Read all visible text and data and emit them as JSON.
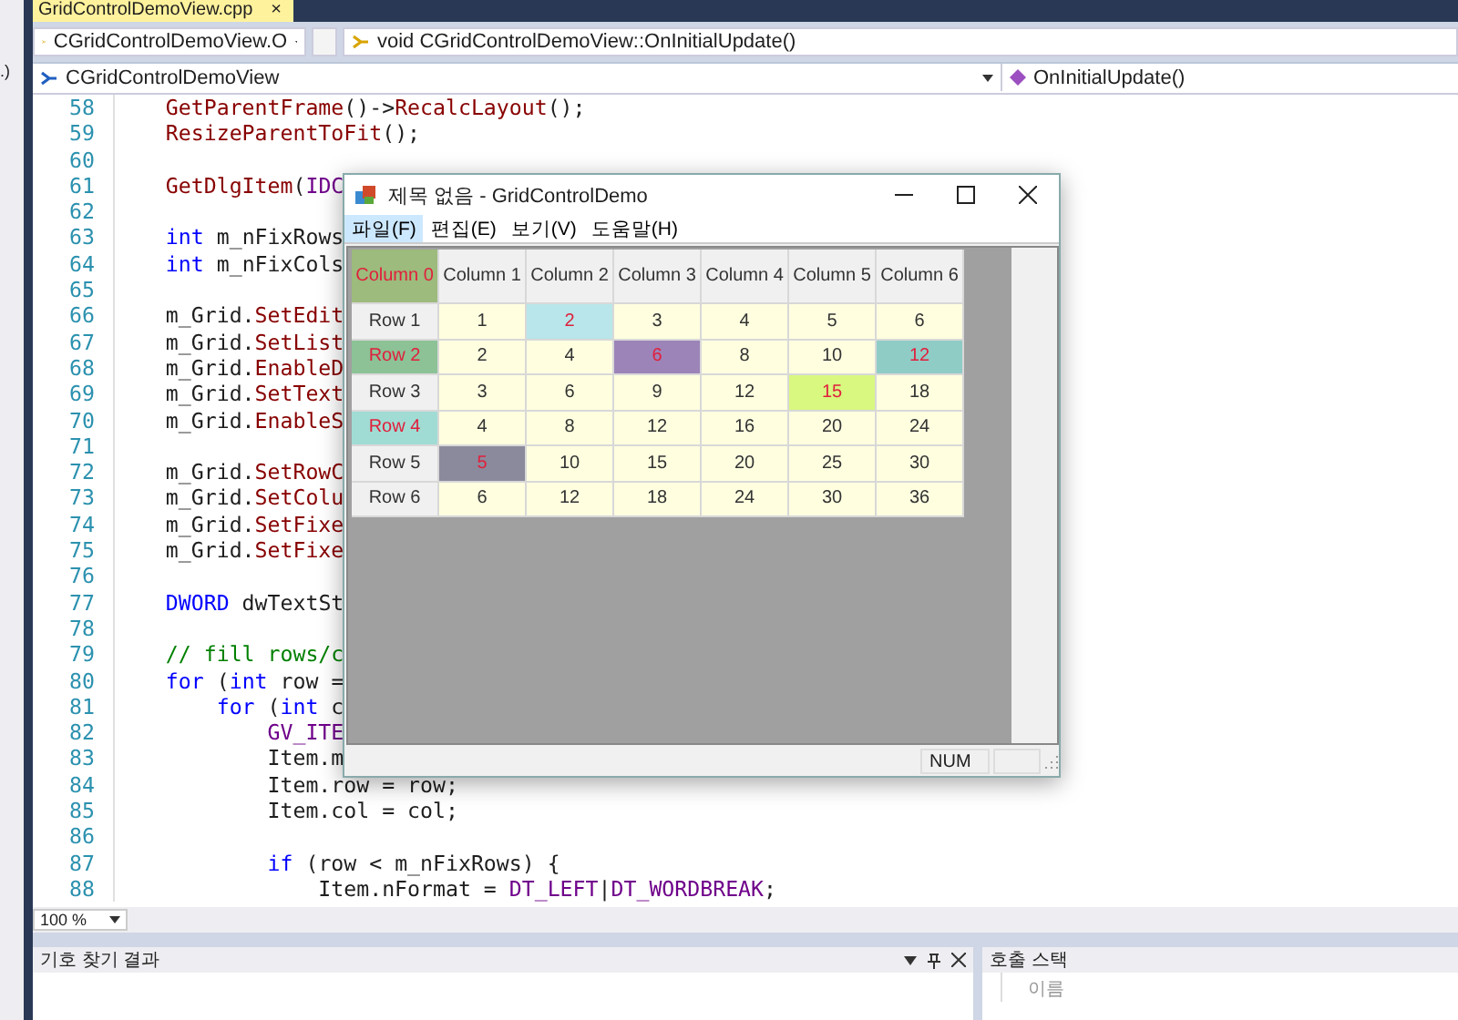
{
  "side_panel": {
    "text": ".)"
  },
  "tabs": [
    {
      "label": "GridControlDemoView.cpp",
      "close": "×",
      "selected": true
    }
  ],
  "navigation": {
    "scope": "CGridControlDemoView.O",
    "member": "void CGridControlDemoView::OnInitialUpdate()",
    "class": "CGridControlDemoView",
    "method": "OnInitialUpdate()"
  },
  "code_lines": [
    {
      "number": "58",
      "tokens": [
        {
          "kind": "fn",
          "text": "    GetParentFrame"
        },
        {
          "kind": "plain",
          "text": "()->"
        },
        {
          "kind": "fn",
          "text": "RecalcLayout"
        },
        {
          "kind": "plain",
          "text": "();"
        }
      ]
    },
    {
      "number": "59",
      "tokens": [
        {
          "kind": "fn",
          "text": "    ResizeParentToFit"
        },
        {
          "kind": "plain",
          "text": "();"
        }
      ]
    },
    {
      "number": "60"
    },
    {
      "number": "61",
      "tokens": [
        {
          "kind": "fn",
          "text": "    GetDlgItem"
        },
        {
          "kind": "plain",
          "text": "("
        },
        {
          "kind": "macro",
          "text": "IDC"
        }
      ]
    },
    {
      "number": "62"
    },
    {
      "number": "63",
      "tokens": [
        {
          "kind": "keyword",
          "text": "    int"
        },
        {
          "kind": "plain",
          "text": " m_nFixRows"
        }
      ]
    },
    {
      "number": "64",
      "tokens": [
        {
          "kind": "keyword",
          "text": "    int"
        },
        {
          "kind": "plain",
          "text": " m_nFixCols"
        }
      ]
    },
    {
      "number": "65"
    },
    {
      "number": "66",
      "tokens": [
        {
          "kind": "plain",
          "text": "    m_Grid."
        },
        {
          "kind": "fn",
          "text": "SetEdit"
        }
      ]
    },
    {
      "number": "67",
      "tokens": [
        {
          "kind": "plain",
          "text": "    m_Grid."
        },
        {
          "kind": "fn",
          "text": "SetList"
        }
      ]
    },
    {
      "number": "68",
      "tokens": [
        {
          "kind": "plain",
          "text": "    m_Grid."
        },
        {
          "kind": "fn",
          "text": "EnableD"
        }
      ]
    },
    {
      "number": "69",
      "tokens": [
        {
          "kind": "plain",
          "text": "    m_Grid."
        },
        {
          "kind": "fn",
          "text": "SetText"
        }
      ]
    },
    {
      "number": "70",
      "tokens": [
        {
          "kind": "plain",
          "text": "    m_Grid."
        },
        {
          "kind": "fn",
          "text": "EnableS"
        }
      ]
    },
    {
      "number": "71"
    },
    {
      "number": "72",
      "tokens": [
        {
          "kind": "plain",
          "text": "    m_Grid."
        },
        {
          "kind": "fn",
          "text": "SetRowC"
        }
      ]
    },
    {
      "number": "73",
      "tokens": [
        {
          "kind": "plain",
          "text": "    m_Grid."
        },
        {
          "kind": "fn",
          "text": "SetColu"
        }
      ]
    },
    {
      "number": "74",
      "tokens": [
        {
          "kind": "plain",
          "text": "    m_Grid."
        },
        {
          "kind": "fn",
          "text": "SetFixe"
        }
      ]
    },
    {
      "number": "75",
      "tokens": [
        {
          "kind": "plain",
          "text": "    m_Grid."
        },
        {
          "kind": "fn",
          "text": "SetFixe"
        }
      ]
    },
    {
      "number": "76"
    },
    {
      "number": "77",
      "tokens": [
        {
          "kind": "keyword",
          "text": "    DWORD"
        },
        {
          "kind": "plain",
          "text": " dwTextSt"
        }
      ]
    },
    {
      "number": "78"
    },
    {
      "number": "79",
      "tokens": [
        {
          "kind": "comment",
          "text": "    // fill rows/c"
        }
      ]
    },
    {
      "number": "80",
      "tokens": [
        {
          "kind": "keyword",
          "text": "    for"
        },
        {
          "kind": "plain",
          "text": " ("
        },
        {
          "kind": "keyword",
          "text": "int"
        },
        {
          "kind": "plain",
          "text": " row ="
        }
      ]
    },
    {
      "number": "81",
      "tokens": [
        {
          "kind": "keyword",
          "text": "        for"
        },
        {
          "kind": "plain",
          "text": " ("
        },
        {
          "kind": "keyword",
          "text": "int"
        },
        {
          "kind": "plain",
          "text": " c"
        }
      ]
    },
    {
      "number": "82",
      "tokens": [
        {
          "kind": "macro",
          "text": "            GV_ITE"
        }
      ]
    },
    {
      "number": "83",
      "tokens": [
        {
          "kind": "plain",
          "text": "            Item.m"
        }
      ]
    },
    {
      "number": "84",
      "tokens": [
        {
          "kind": "plain",
          "text": "            Item.row = row;"
        }
      ]
    },
    {
      "number": "85",
      "tokens": [
        {
          "kind": "plain",
          "text": "            Item.col = col;"
        }
      ]
    },
    {
      "number": "86"
    },
    {
      "number": "87",
      "tokens": [
        {
          "kind": "keyword",
          "text": "            if"
        },
        {
          "kind": "plain",
          "text": " (row < m_nFixRows) {"
        }
      ]
    },
    {
      "number": "88",
      "tokens": [
        {
          "kind": "plain",
          "text": "                Item.nFormat = "
        },
        {
          "kind": "macro",
          "text": "DT_LEFT"
        },
        {
          "kind": "plain",
          "text": "|"
        },
        {
          "kind": "macro",
          "text": "DT_WORDBREAK"
        },
        {
          "kind": "plain",
          "text": ";"
        }
      ]
    }
  ],
  "zoom": "100 %",
  "dialog": {
    "title": "제목 없음 - GridControlDemo",
    "menu": [
      {
        "label": "파일(F)",
        "selected": true
      },
      {
        "label": "편집(E)",
        "selected": false
      },
      {
        "label": "보기(V)",
        "selected": false
      },
      {
        "label": "도움말(H)",
        "selected": false
      }
    ],
    "grid": {
      "rows": [
        [
          {
            "text": "Column 0",
            "color": "#9cbb7c",
            "emphasized": true
          },
          {
            "text": "Column 1",
            "color": "#f0f0f0",
            "emphasized": false
          },
          {
            "text": "Column 2",
            "color": "#f0f0f0",
            "emphasized": false
          },
          {
            "text": "Column 3",
            "color": "#f0f0f0",
            "emphasized": false
          },
          {
            "text": "Column 4",
            "color": "#f0f0f0",
            "emphasized": false
          },
          {
            "text": "Column 5",
            "color": "#f0f0f0",
            "emphasized": false
          },
          {
            "text": "Column 6",
            "color": "#f0f0f0",
            "emphasized": false
          }
        ],
        [
          {
            "text": "Row 1",
            "color": "#f0f0f0",
            "emphasized": false
          },
          {
            "text": "1",
            "color": "#ffffe0",
            "emphasized": false
          },
          {
            "text": "2",
            "color": "#b8e6ea",
            "emphasized": true
          },
          {
            "text": "3",
            "color": "#ffffe0",
            "emphasized": false
          },
          {
            "text": "4",
            "color": "#ffffe0",
            "emphasized": false
          },
          {
            "text": "5",
            "color": "#ffffe0",
            "emphasized": false
          },
          {
            "text": "6",
            "color": "#ffffe0",
            "emphasized": false
          }
        ],
        [
          {
            "text": "Row 2",
            "color": "#8cc296",
            "emphasized": true
          },
          {
            "text": "2",
            "color": "#ffffe0",
            "emphasized": false
          },
          {
            "text": "4",
            "color": "#ffffe0",
            "emphasized": false
          },
          {
            "text": "6",
            "color": "#9c84b8",
            "emphasized": true
          },
          {
            "text": "8",
            "color": "#ffffe0",
            "emphasized": false
          },
          {
            "text": "10",
            "color": "#ffffe0",
            "emphasized": false
          },
          {
            "text": "12",
            "color": "#90ccc6",
            "emphasized": true
          }
        ],
        [
          {
            "text": "Row 3",
            "color": "#f0f0f0",
            "emphasized": false
          },
          {
            "text": "3",
            "color": "#ffffe0",
            "emphasized": false
          },
          {
            "text": "6",
            "color": "#ffffe0",
            "emphasized": false
          },
          {
            "text": "9",
            "color": "#ffffe0",
            "emphasized": false
          },
          {
            "text": "12",
            "color": "#ffffe0",
            "emphasized": false
          },
          {
            "text": "15",
            "color": "#d8f880",
            "emphasized": true
          },
          {
            "text": "18",
            "color": "#ffffe0",
            "emphasized": false
          }
        ],
        [
          {
            "text": "Row 4",
            "color": "#a0dcd4",
            "emphasized": true
          },
          {
            "text": "4",
            "color": "#ffffe0",
            "emphasized": false
          },
          {
            "text": "8",
            "color": "#ffffe0",
            "emphasized": false
          },
          {
            "text": "12",
            "color": "#ffffe0",
            "emphasized": false
          },
          {
            "text": "16",
            "color": "#ffffe0",
            "emphasized": false
          },
          {
            "text": "20",
            "color": "#ffffe0",
            "emphasized": false
          },
          {
            "text": "24",
            "color": "#ffffe0",
            "emphasized": false
          }
        ],
        [
          {
            "text": "Row 5",
            "color": "#f0f0f0",
            "emphasized": false
          },
          {
            "text": "5",
            "color": "#8a8a9c",
            "emphasized": true
          },
          {
            "text": "10",
            "color": "#ffffe0",
            "emphasized": false
          },
          {
            "text": "15",
            "color": "#ffffe0",
            "emphasized": false
          },
          {
            "text": "20",
            "color": "#ffffe0",
            "emphasized": false
          },
          {
            "text": "25",
            "color": "#ffffe0",
            "emphasized": false
          },
          {
            "text": "30",
            "color": "#ffffe0",
            "emphasized": false
          }
        ],
        [
          {
            "text": "Row 6",
            "color": "#f0f0f0",
            "emphasized": false
          },
          {
            "text": "6",
            "color": "#ffffe0",
            "emphasized": false
          },
          {
            "text": "12",
            "color": "#ffffe0",
            "emphasized": false
          },
          {
            "text": "18",
            "color": "#ffffe0",
            "emphasized": false
          },
          {
            "text": "24",
            "color": "#ffffe0",
            "emphasized": false
          },
          {
            "text": "30",
            "color": "#ffffe0",
            "emphasized": false
          },
          {
            "text": "36",
            "color": "#ffffe0",
            "emphasized": false
          }
        ]
      ]
    },
    "status": "NUM"
  },
  "bottom_panels": {
    "symbol_results": {
      "title": "기호 찾기 결과"
    },
    "call_stack": {
      "title": "호출 스택",
      "columns": [
        "이름"
      ]
    }
  }
}
